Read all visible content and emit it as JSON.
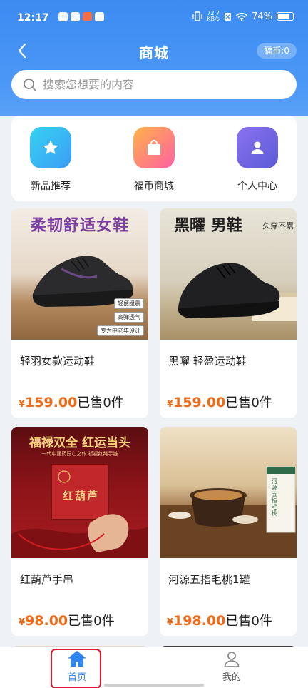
{
  "status_bar": {
    "time": "12:17",
    "speed_top": "72.7",
    "speed_bottom": "KB/s",
    "battery": "74%"
  },
  "nav": {
    "title": "商城",
    "coins": "福币:0"
  },
  "search": {
    "placeholder": "搜索您想要的内容"
  },
  "quick_menu": [
    {
      "label": "新品推荐",
      "icon": "star-icon",
      "color_from": "#36d1f2",
      "color_to": "#3b9df5"
    },
    {
      "label": "福币商城",
      "icon": "shopping-bag-icon",
      "color_from": "#ffb347",
      "color_to": "#ff5fa2"
    },
    {
      "label": "个人中心",
      "icon": "person-icon",
      "color_from": "#8a72f0",
      "color_to": "#5b5bd6"
    }
  ],
  "products": [
    {
      "name": "轻羽女款运动鞋",
      "price_symbol": "¥",
      "price": "159.00",
      "sold": "已售0件",
      "banner": "柔韧舒适女鞋",
      "tags": [
        "轻便缓震",
        "高弹透气",
        "专为中老年设计"
      ]
    },
    {
      "name": "黑曜 轻盈运动鞋",
      "price_symbol": "¥",
      "price": "159.00",
      "sold": "已售0件",
      "banner": "黑曜 男鞋",
      "banner_sub": "久穿不累"
    },
    {
      "name": "红葫芦手串",
      "price_symbol": "¥",
      "price": "98.00",
      "sold": "已售0件",
      "banner": "福禄双全 红运当头",
      "banner_sub": "一代中医药匠心之作 祈福红绳手链",
      "box_text": "红葫芦"
    },
    {
      "name": "河源五指毛桃1罐",
      "price_symbol": "¥",
      "price": "198.00",
      "sold": "已售0件",
      "box_text": "河源五指毛桃"
    }
  ],
  "tabs": [
    {
      "label": "首页",
      "icon": "home-icon",
      "active": true
    },
    {
      "label": "我的",
      "icon": "user-icon",
      "active": false
    }
  ],
  "colors": {
    "accent": "#3d8bf2",
    "price": "#f06a17",
    "highlight": "#e3172c"
  }
}
